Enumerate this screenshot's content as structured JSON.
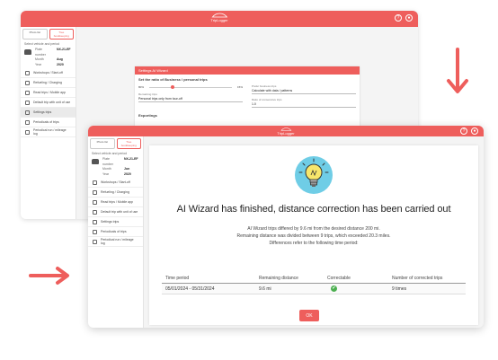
{
  "brand": {
    "logo_text": "TripLogger",
    "accent": "#ee5e5c"
  },
  "icons": {
    "help": "?",
    "user": "●",
    "check": "✔"
  },
  "back_window": {
    "sidebar": {
      "tabs": [
        "Photo list",
        "Tree bookkeeping"
      ],
      "select_label": "Select vehicle and period",
      "vehicle": [
        {
          "k": "Plate number",
          "v": "NX-21-EF"
        },
        {
          "k": "Month",
          "v": "Aug"
        },
        {
          "k": "Year",
          "v": "2020"
        }
      ],
      "menu": [
        "Workshops / Start-off",
        "Refueling / Charging",
        "Read trips / Mobile app",
        "Default trip with unit of use",
        "Settings trips",
        "Periodicals of trips",
        "Periodical run / mileage log"
      ],
      "active_index": 4
    },
    "card": {
      "title": "Settings AI Wizard",
      "section": "Set the ratio of Business / personal trips",
      "business_label": "Business",
      "business_value": "80%",
      "personal_label": "Personal",
      "personal_value": "15%",
      "f1_label": "Prefer business trips",
      "f1_value": "Calculate with data / patterns",
      "f2_label": "Remaining trips",
      "f2_value": "Personal trips only from tour-off",
      "f3_label": "Ratio of consecutive trips",
      "f3_value": "1.0",
      "exp_label": "Exportings"
    }
  },
  "front_window": {
    "sidebar": {
      "tabs": [
        "Photo list",
        "Tree bookkeeping"
      ],
      "select_label": "Select vehicle and period",
      "vehicle": [
        {
          "k": "Plate number",
          "v": "NX-21-EF"
        },
        {
          "k": "Month",
          "v": "Jun"
        },
        {
          "k": "Year",
          "v": "2020"
        }
      ],
      "menu": [
        "Workshops / Start-off",
        "Refueling / Charging",
        "Read trips / Mobile app",
        "Default trip with unit of use",
        "Settings trips",
        "Periodicals of trips",
        "Periodical run / mileage log"
      ]
    },
    "modal": {
      "title": "AI Wizard has finished, distance correction has been carried out",
      "lines": [
        "AI Wizard trips differed by 9.6 mi from the desired distance 200 mi.",
        "Remaining distance was divided between 9 trips, which exceeded 20.3 miles.",
        "Differences refer to the following time period:"
      ],
      "columns": [
        "Time period",
        "Remaining distance",
        "Correctable",
        "Number of corrected trips"
      ],
      "row": {
        "period": "05/01/2024 - 05/31/2024",
        "distance": "9.6 mi",
        "trips": "9 times"
      },
      "ok_label": "OK"
    }
  }
}
